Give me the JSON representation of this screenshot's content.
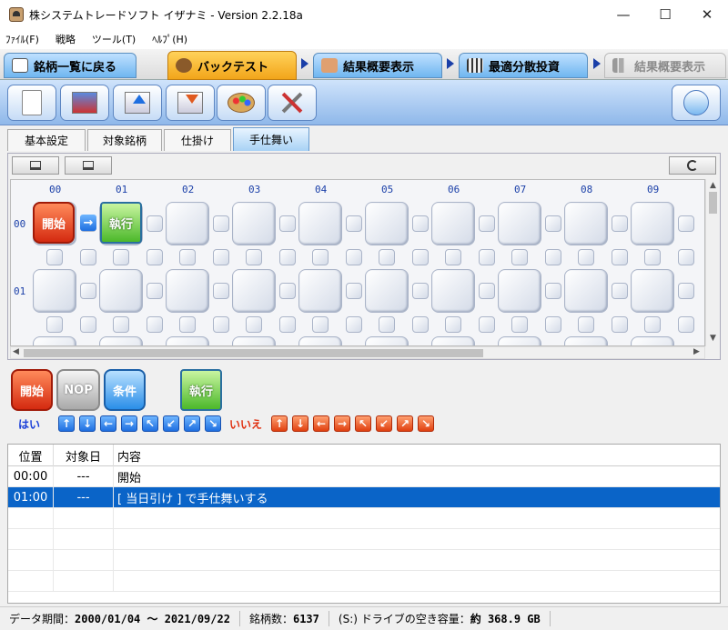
{
  "window": {
    "title": "株システムトレードソフト イザナミ - Version 2.2.18a",
    "minimize": "—",
    "maximize": "☐",
    "close": "✕"
  },
  "menu": [
    "ﾌｧｲﾙ(F)",
    "戦略",
    "ツール(T)",
    "ﾍﾙﾌﾟ(H)"
  ],
  "nav": {
    "back_label": "銘柄一覧に戻る",
    "backtest_label": "バックテスト",
    "summary_label": "結果概要表示",
    "optimal_label": "最適分散投資",
    "summary2_label": "結果概要表示"
  },
  "toolbar_icons": [
    "new-document-icon",
    "database-icon",
    "export-icon",
    "import-icon",
    "palette-icon",
    "tools-icon",
    "notes-icon"
  ],
  "subtabs": [
    "基本設定",
    "対象銘柄",
    "仕掛け",
    "手仕舞い"
  ],
  "active_subtab": "手仕舞い",
  "grid": {
    "columns": [
      "00",
      "01",
      "02",
      "03",
      "04",
      "05",
      "06",
      "07",
      "08",
      "09"
    ],
    "rows": [
      "00",
      "01"
    ],
    "start_node": "開始",
    "exec_node": "執行",
    "arrow": "→"
  },
  "palette": {
    "start": "開始",
    "nop": "NOP",
    "condition": "条件",
    "exec": "執行",
    "yes": "はい",
    "no": "いいえ",
    "yes_arrows": [
      "↑",
      "↓",
      "←",
      "→",
      "↖",
      "↙",
      "↗",
      "↘"
    ],
    "no_arrows": [
      "↑",
      "↓",
      "←",
      "→",
      "↖",
      "↙",
      "↗",
      "↘"
    ]
  },
  "table": {
    "headers": [
      "位置",
      "対象日",
      "内容"
    ],
    "rows": [
      {
        "pos": "00:00",
        "day": "---",
        "content": "開始"
      },
      {
        "pos": "01:00",
        "day": "---",
        "content": "[ 当日引け ] で手仕舞いする"
      }
    ],
    "selected_row": 1
  },
  "status": {
    "period_label": "データ期間：",
    "period_value": "2000/01/04 〜 2021/09/22",
    "count_label": "銘柄数：",
    "count_value": "6137",
    "disk_label": "(S:) ドライブの空き容量：",
    "disk_value": "約 368.9 GB"
  },
  "colors": {
    "accent_blue": "#1f6fe0",
    "start_red": "#d42a10",
    "exec_green": "#4cb82a",
    "selection": "#0a64c8"
  }
}
